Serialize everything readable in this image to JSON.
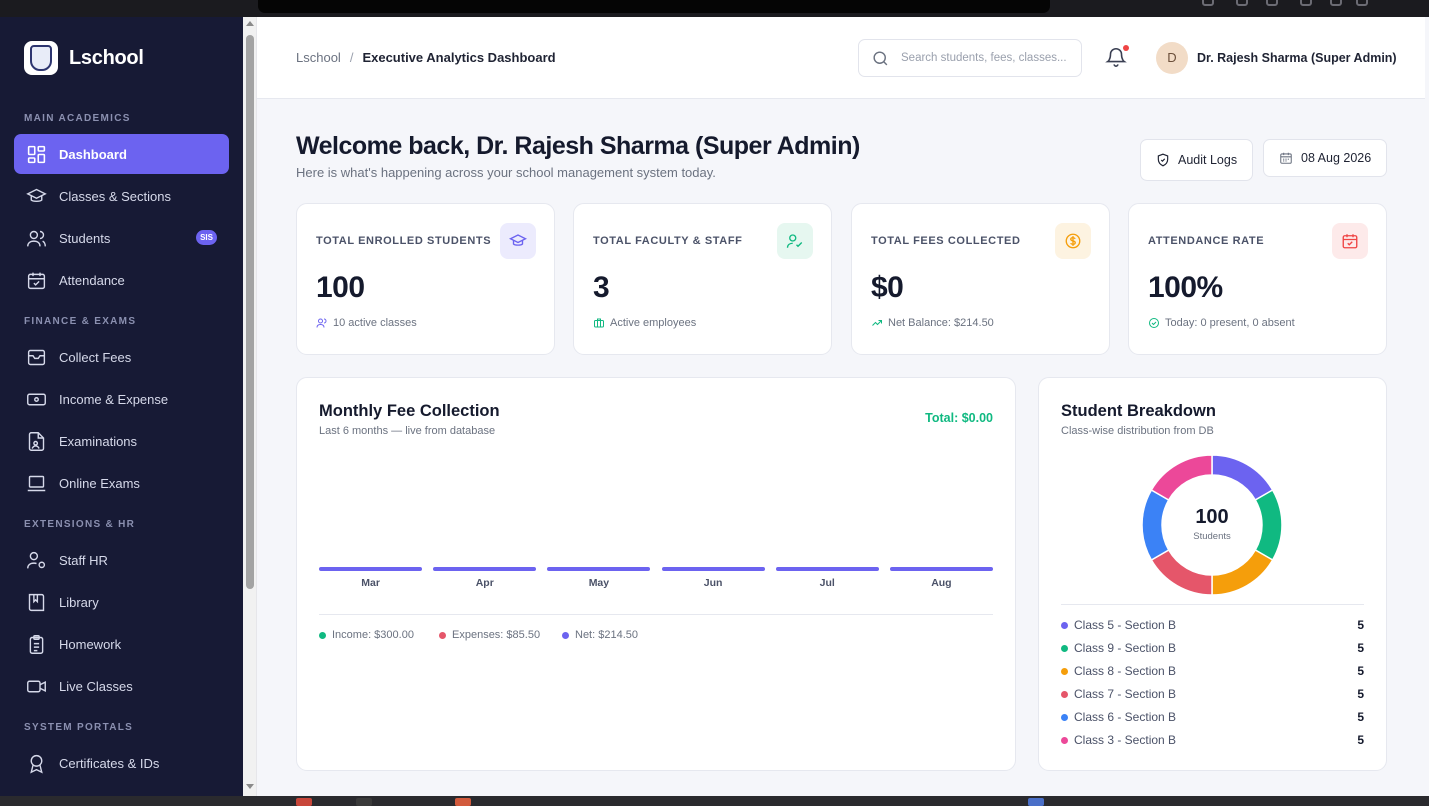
{
  "app": {
    "name": "Lschool"
  },
  "sidebar": {
    "sections": [
      {
        "title": "MAIN ACADEMICS",
        "items": [
          {
            "label": "Dashboard",
            "icon": "grid-icon",
            "active": true
          },
          {
            "label": "Classes & Sections",
            "icon": "graduation-cap-icon"
          },
          {
            "label": "Students",
            "icon": "users-icon",
            "badge": "SIS"
          },
          {
            "label": "Attendance",
            "icon": "calendar-check-icon"
          }
        ]
      },
      {
        "title": "FINANCE & EXAMS",
        "items": [
          {
            "label": "Collect Fees",
            "icon": "inbox-icon"
          },
          {
            "label": "Income & Expense",
            "icon": "banknote-icon"
          },
          {
            "label": "Examinations",
            "icon": "file-user-icon"
          },
          {
            "label": "Online Exams",
            "icon": "laptop-icon"
          }
        ]
      },
      {
        "title": "EXTENSIONS & HR",
        "items": [
          {
            "label": "Staff HR",
            "icon": "user-cog-icon"
          },
          {
            "label": "Library",
            "icon": "book-icon"
          },
          {
            "label": "Homework",
            "icon": "clipboard-list-icon"
          },
          {
            "label": "Live Classes",
            "icon": "video-icon"
          }
        ]
      },
      {
        "title": "SYSTEM PORTALS",
        "items": [
          {
            "label": "Certificates & IDs",
            "icon": "award-icon"
          }
        ]
      }
    ]
  },
  "header": {
    "breadcrumb": [
      "Lschool",
      "Executive Analytics Dashboard"
    ],
    "search_placeholder": "Search students, fees, classes...",
    "user_initial": "D",
    "user_name": "Dr. Rajesh Sharma (Super Admin)"
  },
  "welcome": {
    "title": "Welcome back, Dr. Rajesh Sharma (Super Admin)",
    "subtitle": "Here is what's happening across your school management system today.",
    "audit_label": "Audit Logs",
    "date": "08 Aug 2026"
  },
  "stats": [
    {
      "label": "TOTAL ENROLLED STUDENTS",
      "value": "100",
      "sub": "10 active classes",
      "color": "#6c63f0",
      "bg": "#ecebfd"
    },
    {
      "label": "TOTAL FACULTY & STAFF",
      "value": "3",
      "sub": "Active employees",
      "color": "#10b981",
      "bg": "#e6f7f0"
    },
    {
      "label": "TOTAL FEES COLLECTED",
      "value": "$0",
      "sub": "Net Balance: $214.50",
      "color": "#f59e0b",
      "bg": "#fdf3e1"
    },
    {
      "label": "ATTENDANCE RATE",
      "value": "100%",
      "sub": "Today: 0 present, 0 absent",
      "color": "#ef4444",
      "bg": "#fdeaea"
    }
  ],
  "fee_chart": {
    "title": "Monthly Fee Collection",
    "subtitle": "Last 6 months — live from database",
    "total": "Total: $0.00",
    "legend": [
      {
        "label": "Income: $300.00",
        "color": "#10b981"
      },
      {
        "label": "Expenses: $85.50",
        "color": "#e5566a"
      },
      {
        "label": "Net: $214.50",
        "color": "#6c63f0"
      }
    ]
  },
  "chart_data": {
    "type": "bar",
    "categories": [
      "Mar",
      "Apr",
      "May",
      "Jun",
      "Jul",
      "Aug"
    ],
    "values": [
      0,
      0,
      0,
      0,
      0,
      0
    ]
  },
  "breakdown": {
    "title": "Student Breakdown",
    "subtitle": "Class-wise distribution from DB",
    "center_value": "100",
    "center_label": "Students",
    "rows": [
      {
        "label": "Class 5 - Section B",
        "value": "5",
        "color": "#6c63f0"
      },
      {
        "label": "Class 9 - Section B",
        "value": "5",
        "color": "#10b981"
      },
      {
        "label": "Class 8 - Section B",
        "value": "5",
        "color": "#f59e0b"
      },
      {
        "label": "Class 7 - Section B",
        "value": "5",
        "color": "#e5566a"
      },
      {
        "label": "Class 6 - Section B",
        "value": "5",
        "color": "#3b82f6"
      },
      {
        "label": "Class 3 - Section B",
        "value": "5",
        "color": "#ec4899"
      }
    ]
  }
}
